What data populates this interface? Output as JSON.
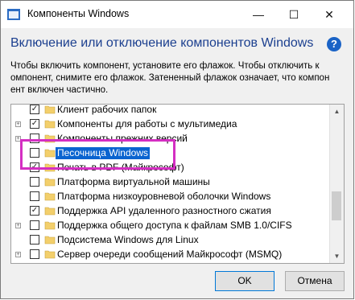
{
  "window": {
    "title": "Компоненты Windows",
    "minimize": "—",
    "maximize": "☐",
    "close": "✕"
  },
  "header": {
    "heading": "Включение или отключение компонентов Windows",
    "help": "?"
  },
  "description": [
    "Чтобы включить компонент, установите его флажок. Чтобы отключить к",
    "омпонент, снимите его флажок. Затененный флажок означает, что компон",
    "ент включен частично."
  ],
  "features": [
    {
      "label": "Клиент рабочих папок",
      "checked": true,
      "expandable": false
    },
    {
      "label": "Компоненты для работы с мультимедиа",
      "checked": true,
      "expandable": true
    },
    {
      "label": "Компоненты прежних версий",
      "checked": false,
      "expandable": true
    },
    {
      "label": "Песочница Windows",
      "checked": false,
      "expandable": false,
      "selected": true
    },
    {
      "label": "Печать в PDF (Майкрософт)",
      "checked": true,
      "expandable": false
    },
    {
      "label": "Платформа виртуальной машины",
      "checked": false,
      "expandable": false
    },
    {
      "label": "Платформа низкоуровневой оболочки Windows",
      "checked": false,
      "expandable": false
    },
    {
      "label": "Поддержка API удаленного разностного сжатия",
      "checked": true,
      "expandable": false
    },
    {
      "label": "Поддержка общего доступа к файлам SMB 1.0/CIFS",
      "checked": false,
      "expandable": true
    },
    {
      "label": "Подсистема Windows для Linux",
      "checked": false,
      "expandable": false
    },
    {
      "label": "Сервер очереди сообщений Майкрософт (MSMQ)",
      "checked": false,
      "expandable": true
    }
  ],
  "buttons": {
    "ok": "OK",
    "cancel": "Отмена"
  },
  "colors": {
    "heading": "#1b3f8f",
    "selection": "#0a64d0",
    "highlight_box": "#d42fc2",
    "folder": "#f3cf6b"
  }
}
